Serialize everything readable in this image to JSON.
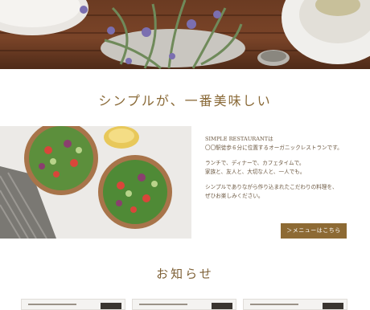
{
  "hero": {
    "alt": ""
  },
  "headline": "シンプルが、一番美味しい",
  "intro": {
    "lines_block1": [
      "SIMPLE RESTAURANTは",
      "〇〇駅徒歩６分に位置するオーガニックレストランです。"
    ],
    "lines_block2": [
      "ランチで、ディナーで、カフェタイムで。",
      "家族と、友人と、大切な人と、一人でも。"
    ],
    "lines_block3": [
      "シンプルでありながら作り込まれたこだわりの料理を、",
      "ぜひお楽しみください。"
    ]
  },
  "menu_button": {
    "label": "＞メニューはこちら"
  },
  "news": {
    "title": "お知らせ",
    "cards": 3
  },
  "colors": {
    "accent": "#8d6a34",
    "heading": "#8a6a38"
  }
}
